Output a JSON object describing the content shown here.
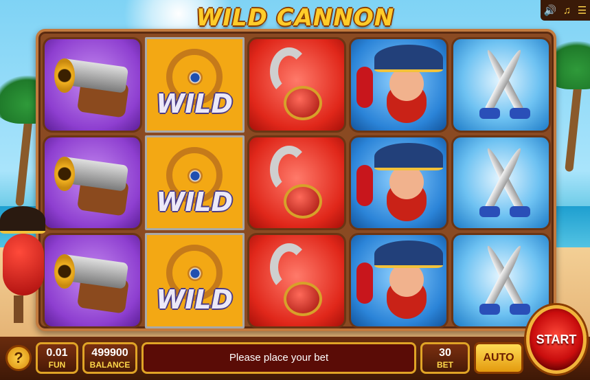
{
  "title": "WILD CANNON",
  "sound": {
    "sound_icon": "speaker-icon",
    "music_icon": "music-icon",
    "menu_icon": "menu-icon"
  },
  "reels": [
    [
      "cannon",
      "wild",
      "hook",
      "captain",
      "swords"
    ],
    [
      "cannon",
      "wild",
      "hook",
      "captain",
      "swords"
    ],
    [
      "cannon",
      "wild",
      "hook",
      "captain",
      "swords"
    ]
  ],
  "wild_label": "WILD",
  "controls": {
    "help_label": "?",
    "coin_value": "0.01",
    "coin_label": "FUN",
    "balance_value": "499900",
    "balance_label": "BALANCE",
    "message": "Please place your bet",
    "bet_value": "30",
    "bet_label": "BET",
    "auto_label": "AUTO",
    "start_label": "START"
  },
  "colors": {
    "accent": "#e0a426",
    "bar": "#4a1a06",
    "start": "#c90d0d"
  }
}
